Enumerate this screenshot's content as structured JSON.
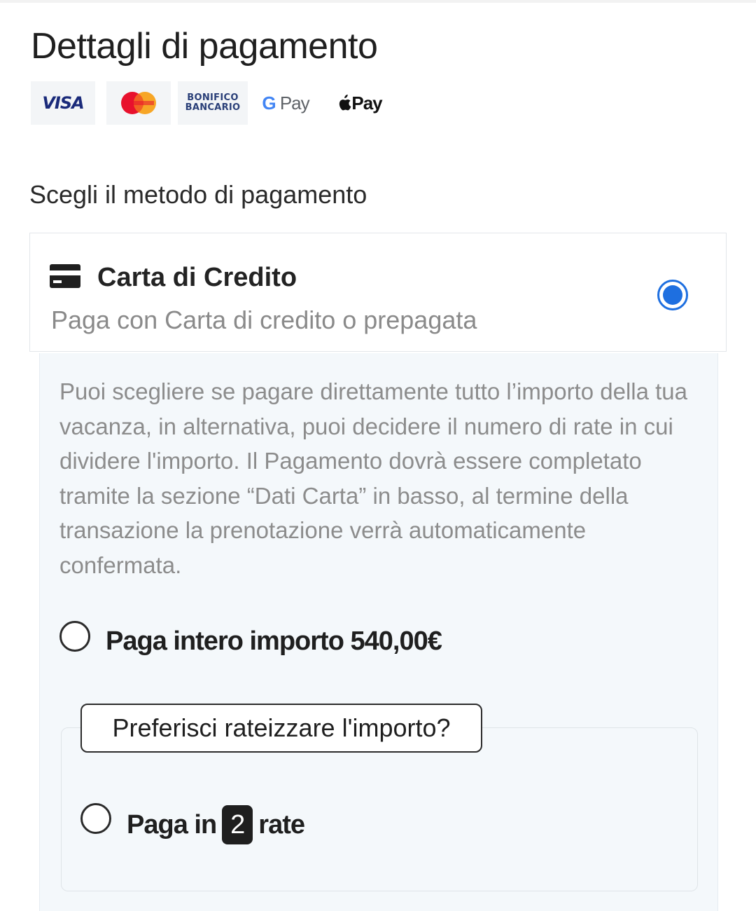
{
  "page": {
    "title": "Dettagli di pagamento",
    "section_label": "Scegli il metodo di pagamento"
  },
  "payment_logos": [
    {
      "name": "visa",
      "text": "VISA"
    },
    {
      "name": "mastercard",
      "text": "MasterCard"
    },
    {
      "name": "bonifico-bancario",
      "line1": "BONIFICO",
      "line2": "BANCARIO"
    },
    {
      "name": "google-pay",
      "g": "G",
      "text": "Pay"
    },
    {
      "name": "apple-pay",
      "text": "Pay"
    }
  ],
  "method": {
    "title": "Carta di Credito",
    "subtitle": "Paga con Carta di credito o prepagata",
    "selected": true,
    "icon": "credit-card-icon"
  },
  "details": {
    "description": "Puoi scegliere se pagare direttamente tutto l’importo della tua vacanza, in alternativa, puoi decidere il numero di rate in cui dividere l'importo. Il Pagamento dovrà essere completato tramite la sezione “Dati Carta” in basso, al termine della transazione la prenotazione verrà automaticamente confermata.",
    "full_payment_label": "Paga intero importo 540,00€",
    "installment_legend": "Preferisci rateizzare l'importo?",
    "installment_prefix": "Paga in",
    "installment_count": "2",
    "installment_suffix": "rate"
  },
  "colors": {
    "accent": "#1e6fe0",
    "panel_bg": "#f4f8fb",
    "muted_text": "#8c8c8c"
  }
}
